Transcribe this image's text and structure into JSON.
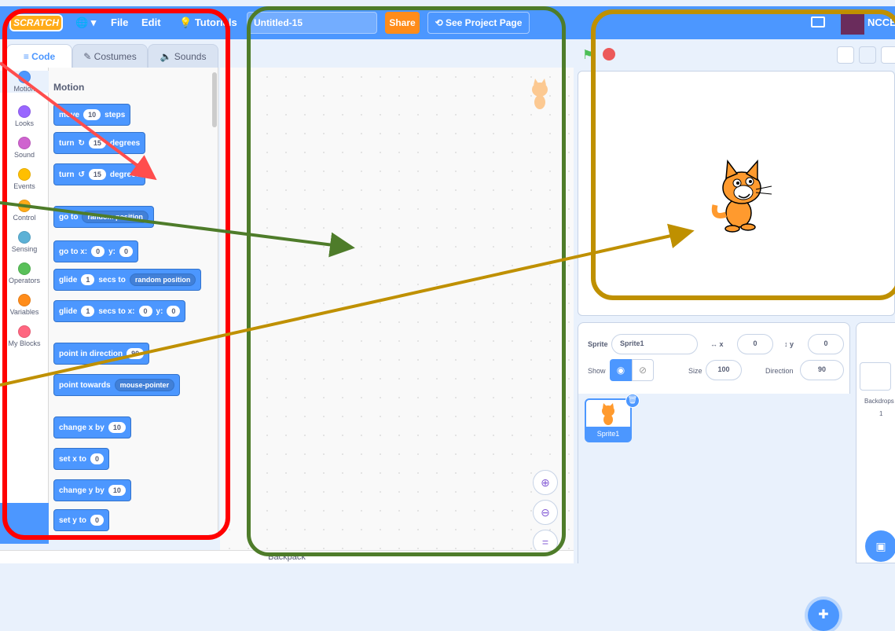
{
  "menubar": {
    "logo": "SCRATCH",
    "file": "File",
    "edit": "Edit",
    "tutorials": "Tutorials",
    "project_title": "Untitled-15",
    "share": "Share",
    "see_project": "See Project Page",
    "account": "NCCE"
  },
  "tabs": {
    "code": "Code",
    "costumes": "Costumes",
    "sounds": "Sounds"
  },
  "categories": [
    {
      "label": "Motion",
      "color": "#4c97ff"
    },
    {
      "label": "Looks",
      "color": "#9966ff"
    },
    {
      "label": "Sound",
      "color": "#cf63cf"
    },
    {
      "label": "Events",
      "color": "#ffbf00"
    },
    {
      "label": "Control",
      "color": "#ffab19"
    },
    {
      "label": "Sensing",
      "color": "#5cb1d6"
    },
    {
      "label": "Operators",
      "color": "#59c059"
    },
    {
      "label": "Variables",
      "color": "#ff8c1a"
    },
    {
      "label": "My Blocks",
      "color": "#ff6680"
    }
  ],
  "palette": {
    "title": "Motion",
    "move_a": "move",
    "move_val": "10",
    "move_b": "steps",
    "turn_cw_a": "turn",
    "turn_cw_val": "15",
    "turn_cw_b": "degrees",
    "turn_ccw_a": "turn",
    "turn_ccw_val": "15",
    "turn_ccw_b": "degrees",
    "goto_a": "go to",
    "goto_dd": "random position",
    "gotoxy_a": "go to x:",
    "gotoxy_x": "0",
    "gotoxy_b": "y:",
    "gotoxy_y": "0",
    "glide_a": "glide",
    "glide_val": "1",
    "glide_b": "secs to",
    "glide_dd": "random position",
    "glidexy_a": "glide",
    "glidexy_val": "1",
    "glidexy_b": "secs to x:",
    "glidexy_x": "0",
    "glidexy_c": "y:",
    "glidexy_y": "0",
    "point_dir_a": "point in direction",
    "point_dir_val": "90",
    "point_tow_a": "point towards",
    "point_tow_dd": "mouse-pointer",
    "changex_a": "change x by",
    "changex_val": "10",
    "setx_a": "set x to",
    "setx_val": "0",
    "changey_a": "change y by",
    "changey_val": "10",
    "sety_a": "set y to",
    "sety_val": "0"
  },
  "backpack": "Backpack",
  "sprite_info": {
    "sprite_label": "Sprite",
    "sprite_name": "Sprite1",
    "x_label": "x",
    "x_val": "0",
    "y_label": "y",
    "y_val": "0",
    "show_label": "Show",
    "size_label": "Size",
    "size_val": "100",
    "direction_label": "Direction",
    "direction_val": "90"
  },
  "sprites": [
    {
      "name": "Sprite1"
    }
  ],
  "stage_panel": {
    "backdrops_label": "Backdrops",
    "backdrops_count": "1"
  },
  "annotations": {
    "red": "#ff0000",
    "green": "#4e7c2a",
    "gold": "#bf9000"
  }
}
